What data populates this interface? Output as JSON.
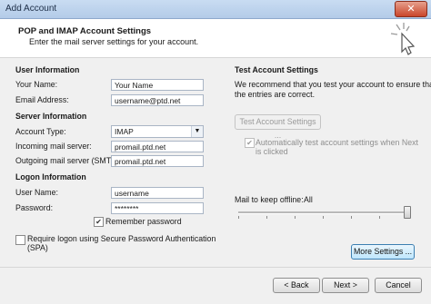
{
  "window": {
    "title": "Add Account",
    "close_glyph": "✕"
  },
  "header": {
    "heading": "POP and IMAP Account Settings",
    "subheading": "Enter the mail server settings for your account."
  },
  "user_info": {
    "section_label": "User Information",
    "name_label": "Your Name:",
    "name_value": "Your Name",
    "email_label": "Email Address:",
    "email_value": "username@ptd.net"
  },
  "server_info": {
    "section_label": "Server Information",
    "account_type_label": "Account Type:",
    "account_type_value": "IMAP",
    "incoming_label": "Incoming mail server:",
    "incoming_value": "promail.ptd.net",
    "outgoing_label": "Outgoing mail server (SMTP):",
    "outgoing_value": "promail.ptd.net"
  },
  "logon_info": {
    "section_label": "Logon Information",
    "username_label": "User Name:",
    "username_value": "username",
    "password_label": "Password:",
    "password_value": "********",
    "remember_label": "Remember password",
    "remember_checked": "✔",
    "spa_label_line1": "Require logon using Secure Password Authentication",
    "spa_label_line2": "(SPA)"
  },
  "test_settings": {
    "section_label": "Test Account Settings",
    "description_line1": "We recommend that you test your account to ensure that",
    "description_line2": "the entries are correct.",
    "test_button": "Test Account Settings ...",
    "auto_test_checked": "✔",
    "auto_test_label_line1": "Automatically test account settings when Next",
    "auto_test_label_line2": "is clicked"
  },
  "offline": {
    "label": "Mail to keep offline:",
    "value": "All",
    "slider_fraction": 1.0
  },
  "buttons": {
    "more_settings": "More Settings ...",
    "back": "< Back",
    "next": "Next >",
    "cancel": "Cancel"
  },
  "icons": {
    "cursor": "pointer-cursor-icon",
    "dropdown": "chevron-down-icon"
  },
  "colors": {
    "accent": "#3c7fb1",
    "titlebar": "#b3cbe8",
    "close_button": "#c9452a"
  }
}
